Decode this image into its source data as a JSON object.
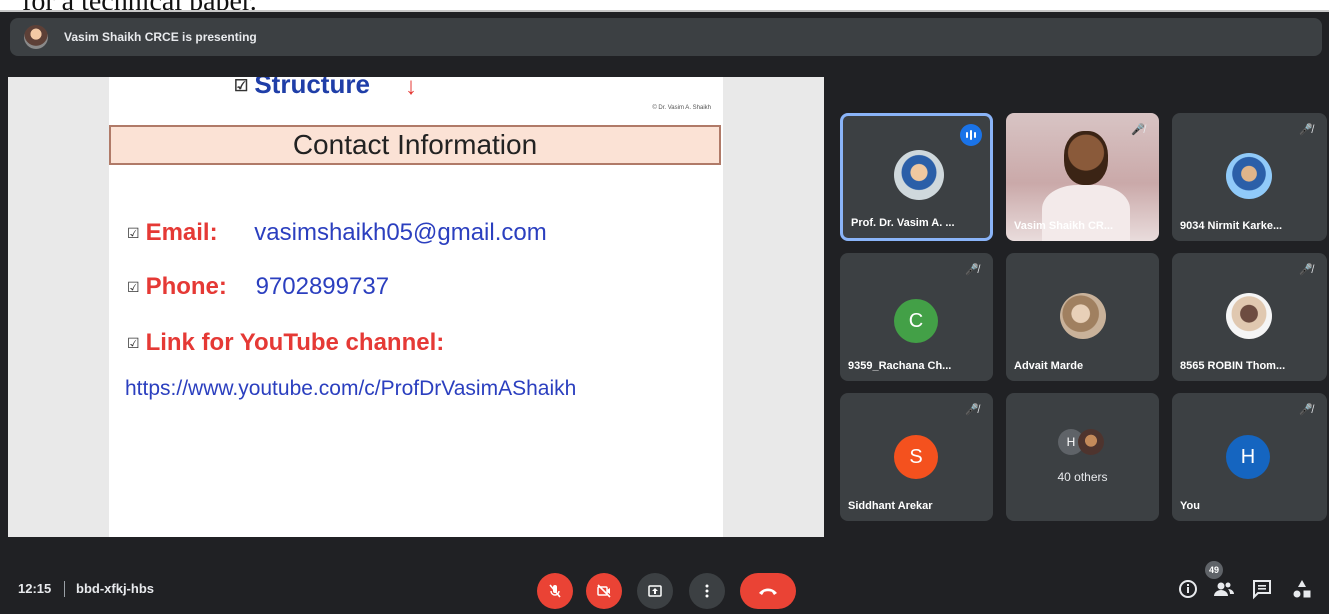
{
  "background_doc": {
    "fragment_text": "for a technical paper."
  },
  "banner": {
    "text": "Vasim Shaikh CRCE is presenting"
  },
  "slide": {
    "heading": "Structure",
    "credit": "© Dr. Vasim A. Shaikh",
    "title": "Contact Information",
    "email_label": "Email:",
    "email_value": "vasimshaikh05@gmail.com",
    "phone_label": "Phone:",
    "phone_value": "9702899737",
    "youtube_label": "Link for YouTube channel:",
    "youtube_url": "https://www.youtube.com/c/ProfDrVasimAShaikh"
  },
  "participants": [
    {
      "name": "Prof. Dr. Vasim A. ...",
      "type": "photo",
      "speaking": true
    },
    {
      "name": "Vasim Shaikh CR...",
      "type": "video",
      "muted": true
    },
    {
      "name": "9034 Nirmit Karke...",
      "type": "photo",
      "muted": true
    },
    {
      "name": "9359_Rachana Ch...",
      "type": "letter",
      "letter": "C",
      "color": "#43a047",
      "muted": true
    },
    {
      "name": "Advait Marde",
      "type": "photo"
    },
    {
      "name": "8565 ROBIN Thom...",
      "type": "photo",
      "muted": true
    },
    {
      "name": "Siddhant Arekar",
      "type": "letter",
      "letter": "S",
      "color": "#f4511e",
      "muted": true
    },
    {
      "name": "40 others",
      "type": "group",
      "letter": "H"
    },
    {
      "name": "You",
      "type": "letter",
      "letter": "H",
      "color": "#1565c0",
      "muted": true
    }
  ],
  "bottom": {
    "time": "12:15",
    "meeting_code": "bbd-xfkj-hbs",
    "people_count": "49"
  },
  "colors": {
    "bg": "#202124",
    "tile": "#3c4043",
    "red": "#ea4335",
    "accent": "#8ab4f8"
  }
}
